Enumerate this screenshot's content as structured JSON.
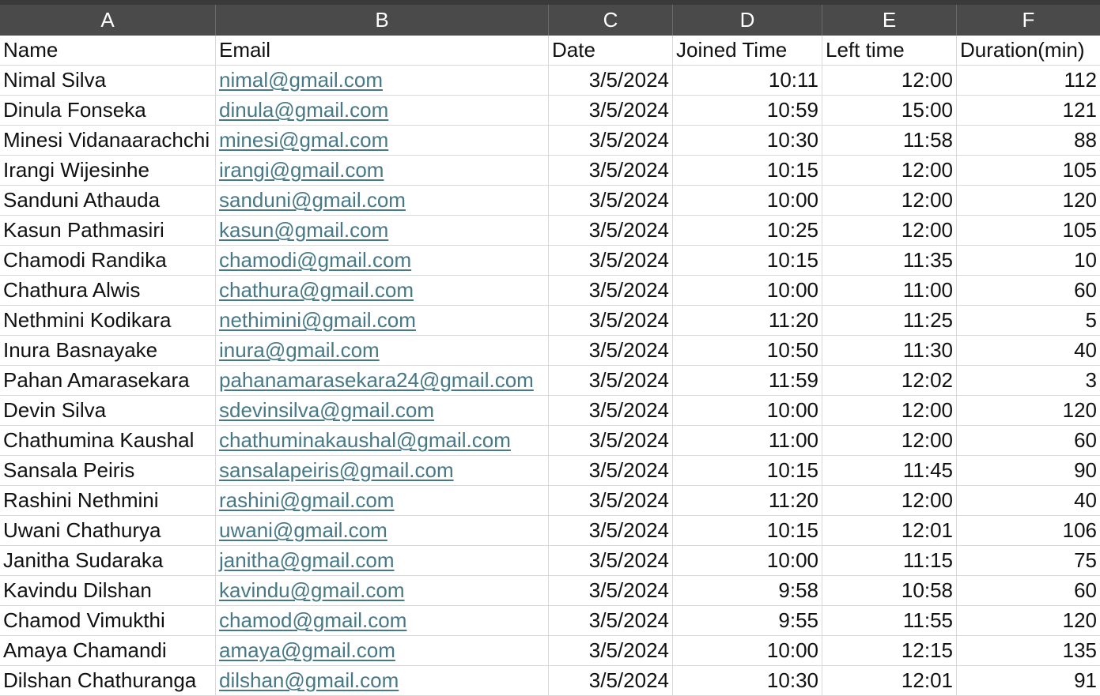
{
  "columns": [
    "A",
    "B",
    "C",
    "D",
    "E",
    "F"
  ],
  "header_row": [
    "Name",
    "Email",
    "Date",
    "Joined Time",
    "Left time",
    "Duration(min)"
  ],
  "rows": [
    [
      "Nimal Silva",
      "nimal@gmail.com",
      "3/5/2024",
      "10:11",
      "12:00",
      "112"
    ],
    [
      "Dinula Fonseka",
      "dinula@gmail.com",
      "3/5/2024",
      "10:59",
      "15:00",
      "121"
    ],
    [
      "Minesi Vidanaarachchi",
      "minesi@gmal.com",
      "3/5/2024",
      "10:30",
      "11:58",
      "88"
    ],
    [
      "Irangi Wijesinhe",
      "irangi@gmail.com",
      "3/5/2024",
      "10:15",
      "12:00",
      "105"
    ],
    [
      "Sanduni Athauda",
      "sanduni@gmail.com",
      "3/5/2024",
      "10:00",
      "12:00",
      "120"
    ],
    [
      "Kasun Pathmasiri",
      "kasun@gmail.com",
      "3/5/2024",
      "10:25",
      "12:00",
      "105"
    ],
    [
      "Chamodi Randika",
      "chamodi@gmail.com",
      "3/5/2024",
      "10:15",
      "11:35",
      "10"
    ],
    [
      "Chathura Alwis",
      "chathura@gmail.com",
      "3/5/2024",
      "10:00",
      "11:00",
      "60"
    ],
    [
      "Nethmini Kodikara",
      "nethimini@gmail.com",
      "3/5/2024",
      "11:20",
      "11:25",
      "5"
    ],
    [
      "Inura Basnayake",
      "inura@gmail.com",
      "3/5/2024",
      "10:50",
      "11:30",
      "40"
    ],
    [
      "Pahan Amarasekara",
      "pahanamarasekara24@gmail.com",
      "3/5/2024",
      "11:59",
      "12:02",
      "3"
    ],
    [
      "Devin Silva",
      "sdevinsilva@gmail.com",
      "3/5/2024",
      "10:00",
      "12:00",
      "120"
    ],
    [
      "Chathumina Kaushal",
      "chathuminakaushal@gmail.com",
      "3/5/2024",
      "11:00",
      "12:00",
      "60"
    ],
    [
      "Sansala Peiris",
      "sansalapeiris@gmail.com",
      "3/5/2024",
      "10:15",
      "11:45",
      "90"
    ],
    [
      "Rashini Nethmini",
      "rashini@gmail.com",
      "3/5/2024",
      "11:20",
      "12:00",
      "40"
    ],
    [
      "Uwani Chathurya",
      "uwani@gmail.com",
      "3/5/2024",
      "10:15",
      "12:01",
      "106"
    ],
    [
      "Janitha Sudaraka",
      "janitha@gmail.com",
      "3/5/2024",
      "10:00",
      "11:15",
      "75"
    ],
    [
      "Kavindu Dilshan",
      "kavindu@gmail.com",
      "3/5/2024",
      "9:58",
      "10:58",
      "60"
    ],
    [
      "Chamod Vimukthi",
      "chamod@gmail.com",
      "3/5/2024",
      "9:55",
      "11:55",
      "120"
    ],
    [
      "Amaya Chamandi",
      "amaya@gmail.com",
      "3/5/2024",
      "10:00",
      "12:15",
      "135"
    ],
    [
      "Dilshan Chathuranga",
      "dilshan@gmail.com",
      "3/5/2024",
      "10:30",
      "12:01",
      "91"
    ]
  ],
  "colors": {
    "column_header_bg": "#4a4a4a",
    "link": "#467886",
    "gridline": "#d9d9d9"
  }
}
